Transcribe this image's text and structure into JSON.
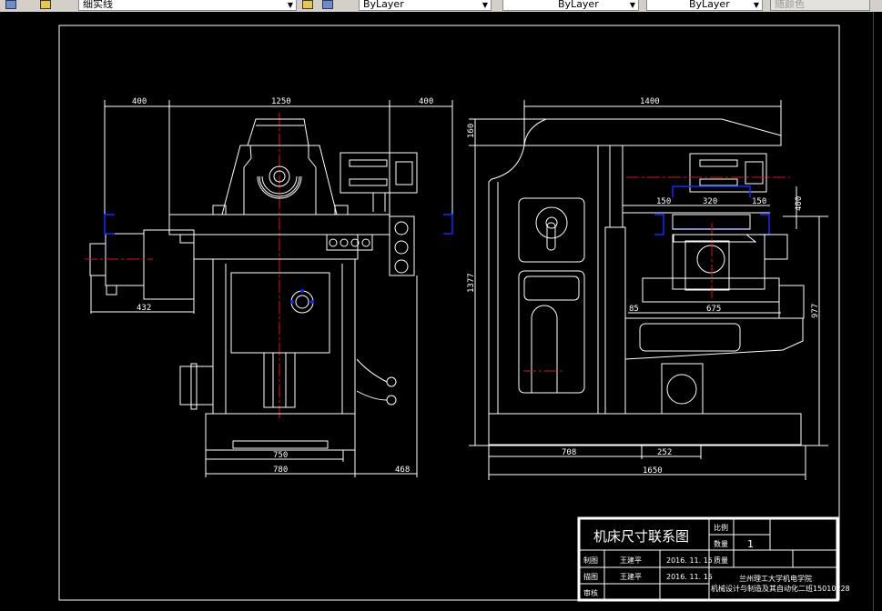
{
  "toolbar": {
    "layer_name": "细实线",
    "color": "ByLayer",
    "linetype": "ByLayer",
    "lineweight": "ByLayer",
    "plot_style": "随颜色"
  },
  "drawing": {
    "left_view_dims": {
      "top_left": "400",
      "top_mid": "1250",
      "top_right": "400",
      "side": "432",
      "bottom_inner": "750",
      "bottom_outer": "780",
      "bottom_right": "468"
    },
    "right_view_dims": {
      "top": "1400",
      "overarm": "160",
      "height": "1377",
      "table_h": "977",
      "head_h": "400",
      "slot_l": "150",
      "slot_mid": "320",
      "slot_r": "150",
      "table_off": "85",
      "table_w": "675",
      "base_l": "708",
      "base_r": "252",
      "base_total": "1650"
    }
  },
  "title_block": {
    "title": "机床尺寸联系图",
    "scale_label": "比例",
    "scale_value": "",
    "qty_label": "数量",
    "qty_value": "1",
    "mass_label": "质量",
    "drawn_label": "制图",
    "drawn_name": "王建平",
    "drawn_date": "2016. 11. 15",
    "traced_label": "描图",
    "traced_name": "王建平",
    "traced_date": "2016. 11. 15",
    "review_label": "审核",
    "school": "兰州理工大学机电学院",
    "class": "机械设计与制造及其自动化二班15010228"
  },
  "colors": {
    "background": "#000000",
    "lines": "#ffffff",
    "centerline": "#e01010",
    "grip": "#1428ff"
  }
}
